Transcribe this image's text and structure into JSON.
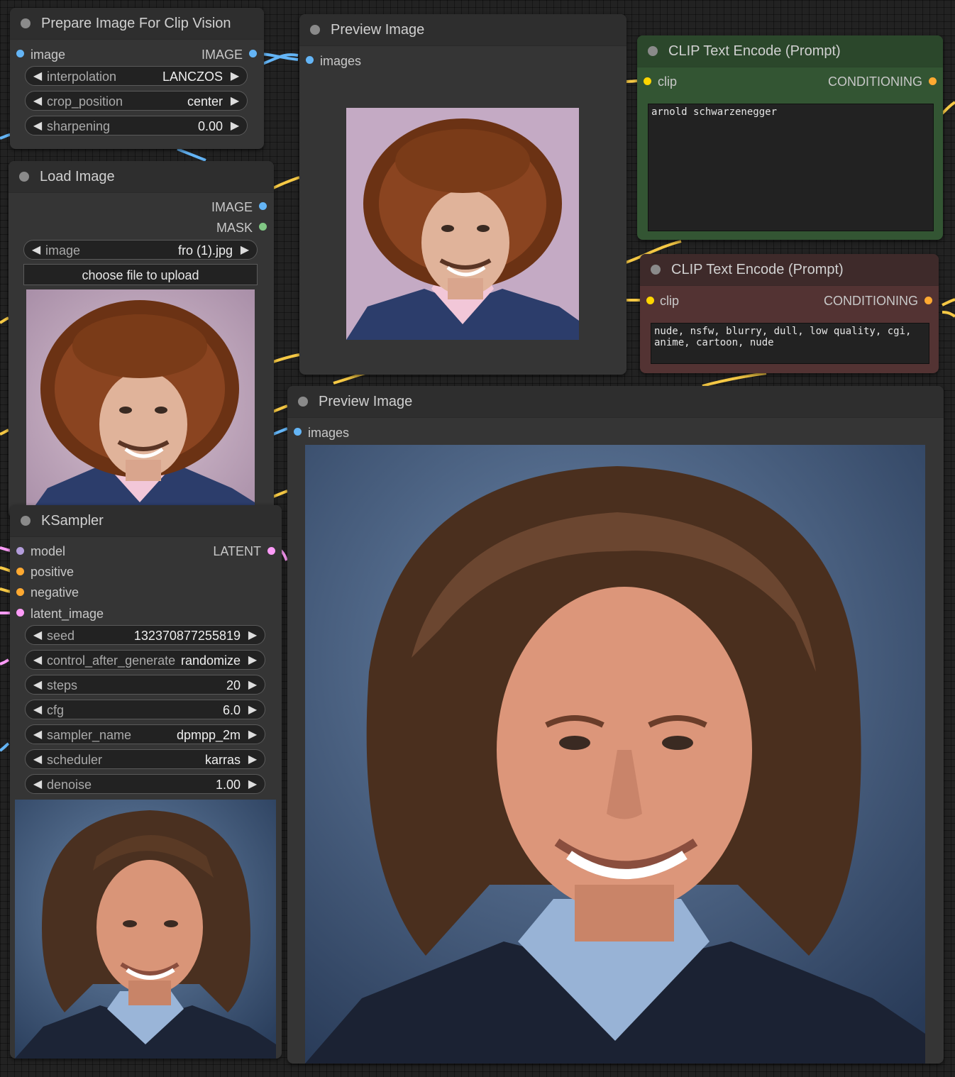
{
  "nodes": {
    "prepare": {
      "title": "Prepare Image For Clip Vision",
      "input_image": "image",
      "output_image": "IMAGE",
      "widgets": [
        {
          "label": "interpolation",
          "value": "LANCZOS"
        },
        {
          "label": "crop_position",
          "value": "center"
        },
        {
          "label": "sharpening",
          "value": "0.00"
        }
      ]
    },
    "load": {
      "title": "Load Image",
      "output_image": "IMAGE",
      "output_mask": "MASK",
      "image_widget": {
        "label": "image",
        "value": "fro (1).jpg"
      },
      "upload_button": "choose file to upload"
    },
    "preview1": {
      "title": "Preview Image",
      "input": "images"
    },
    "clip_pos": {
      "title": "CLIP Text Encode (Prompt)",
      "input": "clip",
      "output": "CONDITIONING",
      "text": "arnold schwarzenegger"
    },
    "clip_neg": {
      "title": "CLIP Text Encode (Prompt)",
      "input": "clip",
      "output": "CONDITIONING",
      "text": "nude, nsfw, blurry, dull, low quality, cgi, anime, cartoon, nude"
    },
    "ksampler": {
      "title": "KSampler",
      "inputs": [
        "model",
        "positive",
        "negative",
        "latent_image"
      ],
      "output": "LATENT",
      "widgets": [
        {
          "label": "seed",
          "value": "132370877255819"
        },
        {
          "label": "control_after_generate",
          "value": "randomize"
        },
        {
          "label": "steps",
          "value": "20"
        },
        {
          "label": "cfg",
          "value": "6.0"
        },
        {
          "label": "sampler_name",
          "value": "dpmpp_2m"
        },
        {
          "label": "scheduler",
          "value": "karras"
        },
        {
          "label": "denoise",
          "value": "1.00"
        }
      ]
    },
    "preview2": {
      "title": "Preview Image",
      "input": "images"
    }
  },
  "colors": {
    "image_socket": "#64b5f6",
    "mask_socket": "#81c784",
    "clip_socket": "#ffd500",
    "conditioning_socket": "#ffa931",
    "latent_socket": "#ff9cf9",
    "model_socket": "#b39ddb",
    "clip_pos_bg": "#335533",
    "clip_neg_bg": "#533333"
  }
}
